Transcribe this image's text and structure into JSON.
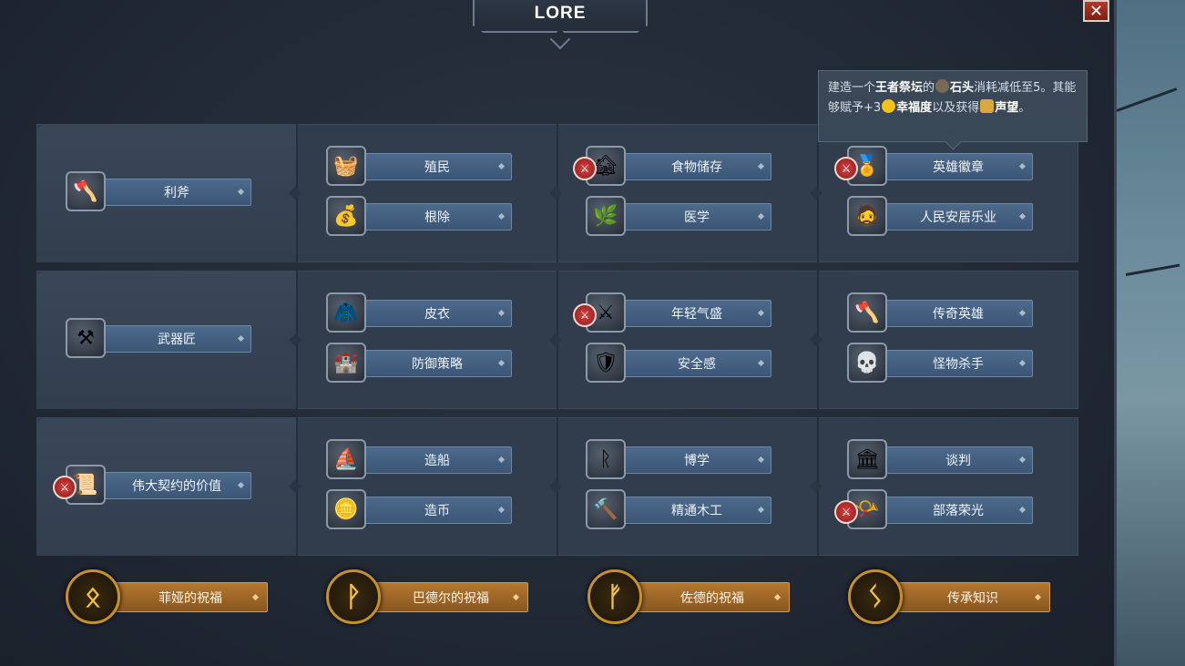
{
  "window": {
    "title": "LORE",
    "close_label": "✕"
  },
  "tooltip": {
    "p1": "建造一个",
    "b1": "王者祭坛",
    "p2": "的",
    "b2": "石头",
    "p3": "消耗减低至5。其能够赋予+3",
    "b3": "幸福度",
    "p4": "以及获得",
    "b4": "声望",
    "p5": "。"
  },
  "badge_glyph": "⚔",
  "rows": [
    {
      "first": {
        "label": "利斧",
        "icon": "axe-icon",
        "glyph": "🪓",
        "badge": false
      },
      "cols": [
        [
          {
            "label": "殖民",
            "icon": "basket-icon",
            "glyph": "🧺",
            "badge": false
          },
          {
            "label": "根除",
            "icon": "sack-icon",
            "glyph": "💰",
            "badge": false
          }
        ],
        [
          {
            "label": "食物储存",
            "icon": "storehouse-icon",
            "glyph": "🏚",
            "badge": true
          },
          {
            "label": "医学",
            "icon": "herb-icon",
            "glyph": "🌿",
            "badge": false
          }
        ],
        [
          {
            "label": "英雄徽章",
            "icon": "medal-icon",
            "glyph": "🏅",
            "badge": true
          },
          {
            "label": "人民安居乐业",
            "icon": "villager-icon",
            "glyph": "🧔",
            "badge": false
          }
        ]
      ]
    },
    {
      "first": {
        "label": "武器匠",
        "icon": "anvil-icon",
        "glyph": "⚒",
        "badge": false
      },
      "cols": [
        [
          {
            "label": "皮衣",
            "icon": "leather-icon",
            "glyph": "🧥",
            "badge": false
          },
          {
            "label": "防御策略",
            "icon": "tower-icon",
            "glyph": "🏰",
            "badge": false
          }
        ],
        [
          {
            "label": "年轻气盛",
            "icon": "crossed-swords-icon",
            "glyph": "⚔",
            "badge": true
          },
          {
            "label": "安全感",
            "icon": "shield-icon",
            "glyph": "🛡",
            "badge": false
          }
        ],
        [
          {
            "label": "传奇英雄",
            "icon": "battle-axe-icon",
            "glyph": "🪓",
            "badge": false
          },
          {
            "label": "怪物杀手",
            "icon": "skull-icon",
            "glyph": "💀",
            "badge": false
          }
        ]
      ]
    },
    {
      "first": {
        "label": "伟大契约的价值",
        "icon": "scroll-icon",
        "glyph": "📜",
        "badge": true
      },
      "cols": [
        [
          {
            "label": "造船",
            "icon": "ship-icon",
            "glyph": "⛵",
            "badge": false
          },
          {
            "label": "造币",
            "icon": "coin-icon",
            "glyph": "🪙",
            "badge": false
          }
        ],
        [
          {
            "label": "博学",
            "icon": "runestone-icon",
            "glyph": "ᚱ",
            "badge": false
          },
          {
            "label": "精通木工",
            "icon": "hammer-icon",
            "glyph": "🔨",
            "badge": false
          }
        ],
        [
          {
            "label": "谈判",
            "icon": "hall-icon",
            "glyph": "🏛",
            "badge": false
          },
          {
            "label": "部落荣光",
            "icon": "horn-icon",
            "glyph": "📯",
            "badge": true
          }
        ]
      ]
    }
  ],
  "blessings": [
    {
      "label": "菲娅的祝福",
      "rune": "ᛟ",
      "icon": "rune-othala-icon"
    },
    {
      "label": "巴德尔的祝福",
      "rune": "ᚹ",
      "icon": "rune-wunjo-icon"
    },
    {
      "label": "佐德的祝福",
      "rune": "ᚠ",
      "icon": "rune-fehu-icon"
    },
    {
      "label": "传承知识",
      "rune": "ᛊ",
      "icon": "rune-sowilo-icon"
    }
  ],
  "colors": {
    "accent": "#4d6a8c",
    "gold": "#c6902e",
    "badge": "#d94141"
  }
}
